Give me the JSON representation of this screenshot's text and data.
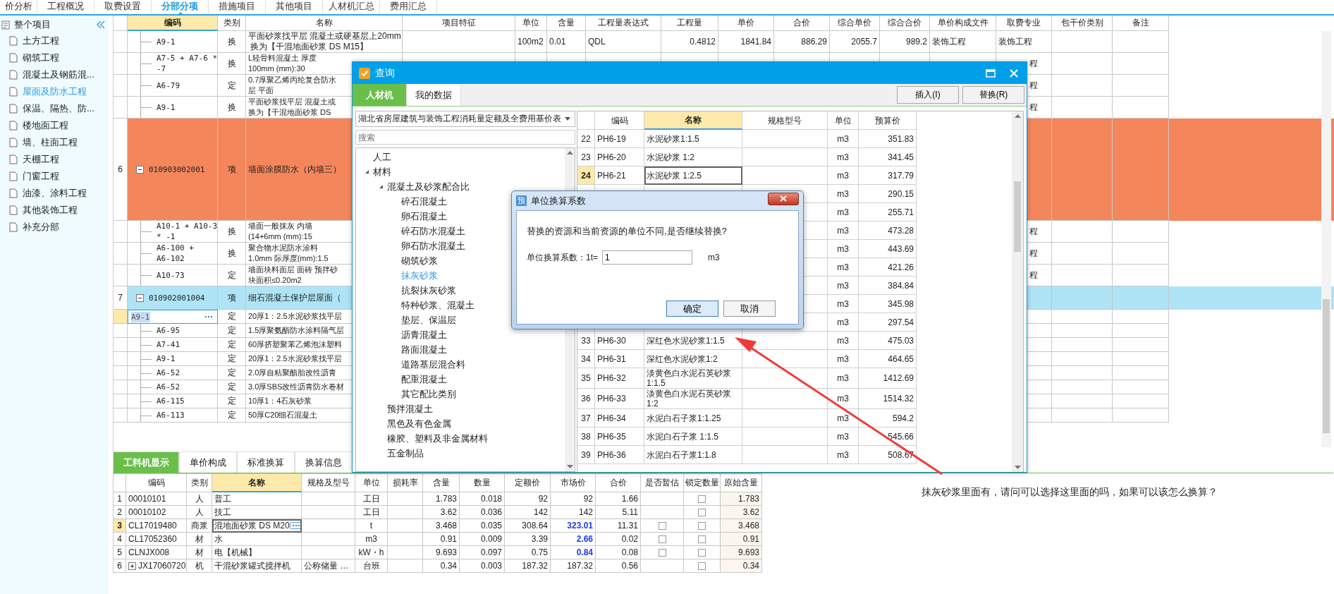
{
  "top_tabs": [
    {
      "label": "价分析",
      "selected": false
    },
    {
      "label": "工程概况",
      "selected": false
    },
    {
      "label": "取费设置",
      "selected": false
    },
    {
      "label": "分部分项",
      "selected": true
    },
    {
      "label": "措施项目",
      "selected": false
    },
    {
      "label": "其他项目",
      "selected": false
    },
    {
      "label": "人材机汇总",
      "selected": false
    },
    {
      "label": "费用汇总",
      "selected": false
    }
  ],
  "sidebar": {
    "root": "整个项目",
    "items": [
      {
        "label": "土方工程",
        "selected": false
      },
      {
        "label": "砌筑工程",
        "selected": false
      },
      {
        "label": "混凝土及钢筋混...",
        "selected": false
      },
      {
        "label": "屋面及防水工程",
        "selected": true
      },
      {
        "label": "保温、隔热、防...",
        "selected": false
      },
      {
        "label": "楼地面工程",
        "selected": false
      },
      {
        "label": "墙、柱面工程",
        "selected": false
      },
      {
        "label": "天棚工程",
        "selected": false
      },
      {
        "label": "门窗工程",
        "selected": false
      },
      {
        "label": "油漆、涂料工程",
        "selected": false
      },
      {
        "label": "其他装饰工程",
        "selected": false
      },
      {
        "label": "补充分部",
        "selected": false
      }
    ]
  },
  "grid": {
    "columns": [
      {
        "label": "编码",
        "current": true
      },
      {
        "label": "类别",
        "current": false
      },
      {
        "label": "名称",
        "current": false
      },
      {
        "label": "项目特征",
        "current": false
      },
      {
        "label": "单位",
        "current": false
      },
      {
        "label": "含量",
        "current": false
      },
      {
        "label": "工程量表达式",
        "current": false
      },
      {
        "label": "工程量",
        "current": false
      },
      {
        "label": "单价",
        "current": false
      },
      {
        "label": "合价",
        "current": false
      },
      {
        "label": "综合单价",
        "current": false
      },
      {
        "label": "综合合价",
        "current": false
      },
      {
        "label": "单价构成文件",
        "current": false
      },
      {
        "label": "取费专业",
        "current": false
      },
      {
        "label": "包干价类别",
        "current": false
      },
      {
        "label": "备注",
        "current": false
      }
    ],
    "groups": [
      {
        "children": [
          {
            "code": "A9-1",
            "type": "换",
            "name": "平面砂浆找平层 混凝土或硬基层上20mm\n 换为【干混地面砂浆 DS M15】",
            "covered": false,
            "editing": false,
            "cells": {
              "unit": "100m2",
              "ratio": "0.01",
              "expr": "QDL",
              "qty": "0.4812",
              "price": "1841.84",
              "total": "886.29",
              "cprice": "2055.7",
              "ctotal": "989.2",
              "file": "装饰工程",
              "fee": "装饰工程"
            }
          },
          {
            "code": "A7-5 + A7-6 *\n-7",
            "type": "换",
            "name": "L轻骨料混凝土 厚度100mm (mm):30",
            "covered": true,
            "editing": false,
            "cells": {
              "fee": "程"
            }
          },
          {
            "code": "A6-79",
            "type": "定",
            "name": "0.7厚聚乙烯丙纶复合防水层 平面",
            "covered": true,
            "editing": false,
            "cells": {
              "fee": "程"
            }
          },
          {
            "code": "A9-1",
            "type": "换",
            "name": "平面砂浆找平层 混凝土或换为【干混地面砂浆 DS",
            "covered": true,
            "editing": false,
            "cells": {
              "fee": "程"
            }
          }
        ]
      },
      {
        "item": {
          "num": "6",
          "code": "010903002001",
          "type": "项",
          "name": "墙面涂膜防水（内墙三）",
          "expanded": true,
          "selected": false
        },
        "children": [
          {
            "code": "A10-1 + A10-3\n* -1",
            "type": "换",
            "name": "墙面一般抹灰 内墙(14+6mm (mm):15",
            "covered": true,
            "editing": false,
            "cells": {
              "fee": "程"
            }
          },
          {
            "code": "A6-100 +\nA6-102",
            "type": "换",
            "name": "聚合物水泥防水涂料 1.0mm 际厚度(mm):1.5",
            "covered": true,
            "editing": false,
            "cells": {
              "fee": "程"
            }
          },
          {
            "code": "A10-73",
            "type": "定",
            "name": "墙面块料面层 面砖 预拌砂块面积≤0.20m2",
            "covered": true,
            "editing": false,
            "cells": {
              "fee": "程"
            }
          }
        ]
      },
      {
        "item": {
          "num": "7",
          "code": "010902001004",
          "type": "项",
          "name": "细石混凝土保护层屋面（",
          "expanded": true,
          "selected": true
        },
        "children": [
          {
            "code": "A9-1",
            "type": "定",
            "name": "20厚1：2.5水泥砂浆找平层",
            "covered": true,
            "editing": true
          },
          {
            "code": "A6-95",
            "type": "定",
            "name": "1.5厚聚氨酯防水涂料隔气层",
            "covered": true,
            "editing": false
          },
          {
            "code": "A7-41",
            "type": "定",
            "name": "60厚挤塑聚苯乙烯泡沫塑料",
            "covered": true,
            "editing": false
          },
          {
            "code": "A9-1",
            "type": "定",
            "name": "20厚1：2.5水泥砂浆找平层",
            "covered": true,
            "editing": false
          },
          {
            "code": "A6-52",
            "type": "定",
            "name": "2.0厚自粘聚酯胎改性沥青",
            "covered": true,
            "editing": false
          },
          {
            "code": "A6-52",
            "type": "定",
            "name": "3.0厚SBS改性沥青防水卷材",
            "covered": true,
            "editing": false
          },
          {
            "code": "A6-115",
            "type": "定",
            "name": "10厚1：4石灰砂浆",
            "covered": true,
            "editing": false
          },
          {
            "code": "A6-113",
            "type": "定",
            "name": "50厚C20细石混凝土",
            "covered": true,
            "editing": false
          }
        ]
      }
    ]
  },
  "bottom_tabs": [
    {
      "label": "工料机显示",
      "selected": true
    },
    {
      "label": "单价构成",
      "selected": false
    },
    {
      "label": "标准换算",
      "selected": false
    },
    {
      "label": "换算信息",
      "selected": false
    }
  ],
  "resource_table": {
    "columns": [
      {
        "label": "编码",
        "current": false
      },
      {
        "label": "类别",
        "current": false
      },
      {
        "label": "名称",
        "current": true
      },
      {
        "label": "规格及型号",
        "current": false
      },
      {
        "label": "单位",
        "current": false
      },
      {
        "label": "损耗率",
        "current": false
      },
      {
        "label": "含量",
        "current": false
      },
      {
        "label": "数量",
        "current": false
      },
      {
        "label": "定额价",
        "current": false
      },
      {
        "label": "市场价",
        "current": false
      },
      {
        "label": "合价",
        "current": false
      },
      {
        "label": "是否暂估",
        "current": false
      },
      {
        "label": "锁定数量",
        "current": false
      },
      {
        "label": "原始含量",
        "current": false
      }
    ],
    "rows": [
      {
        "num": "1",
        "code": "00010101",
        "type": "人",
        "name": "普工",
        "unit": "工日",
        "ratio": "1.783",
        "qty": "0.018",
        "quota_price": "92",
        "market_price": "92",
        "total": "1.66",
        "locked": {
          "checked": false
        },
        "original": "1.783",
        "selected": false,
        "adjusted": false
      },
      {
        "num": "2",
        "code": "00010102",
        "type": "人",
        "name": "技工",
        "unit": "工日",
        "ratio": "3.62",
        "qty": "0.036",
        "quota_price": "142",
        "market_price": "142",
        "total": "5.11",
        "locked": {
          "checked": false
        },
        "original": "3.62",
        "selected": false,
        "adjusted": false
      },
      {
        "num": "3",
        "code": "CL17019480",
        "type": "商浆",
        "name": "混地面砂浆 DS M20",
        "unit": "t",
        "ratio": "3.468",
        "qty": "0.035",
        "quota_price": "308.64",
        "market_price": "323.01",
        "total": "11.31",
        "estimate": {
          "checked": false
        },
        "locked": {
          "checked": false
        },
        "original": "3.468",
        "selected": true,
        "adjusted": true
      },
      {
        "num": "4",
        "code": "CL17052360",
        "type": "材",
        "name": "水",
        "unit": "m3",
        "ratio": "0.91",
        "qty": "0.009",
        "quota_price": "3.39",
        "market_price": "2.66",
        "total": "0.02",
        "estimate": {
          "checked": false
        },
        "locked": {
          "checked": false
        },
        "original": "0.91",
        "selected": false,
        "adjusted": true
      },
      {
        "num": "5",
        "code": "CLNJX008",
        "type": "材",
        "name": "电【机械】",
        "unit": "kW・h",
        "ratio": "9.693",
        "qty": "0.097",
        "quota_price": "0.75",
        "market_price": "0.84",
        "total": "0.08",
        "estimate": {
          "checked": false
        },
        "locked": {
          "checked": false
        },
        "original": "9.693",
        "selected": false,
        "adjusted": true
      },
      {
        "num": "6",
        "code": "JX17060720",
        "type": "机",
        "name": "干混砂浆罐式搅拌机",
        "spec": "公称储量 …",
        "unit": "台班",
        "ratio": "0.34",
        "qty": "0.003",
        "quota_price": "187.32",
        "market_price": "187.32",
        "total": "0.56",
        "locked": {
          "checked": false
        },
        "original": "0.34",
        "selected": false,
        "adjusted": false,
        "expanded": false
      }
    ]
  },
  "query_dialog": {
    "title": "查询",
    "tabs": [
      {
        "label": "人材机",
        "selected": true
      },
      {
        "label": "我的数据",
        "selected": false
      }
    ],
    "buttons": [
      "插入(I)",
      "替换(R)"
    ],
    "library": "湖北省房屋建筑与装饰工程消耗量定额及全费用基价表",
    "search": {
      "placeholder": "搜索"
    },
    "tree": [
      {
        "label": "人工",
        "selected": false
      },
      {
        "label": "材料",
        "selected": false,
        "expanded": true,
        "children": [
          {
            "label": "混凝土及砂浆配合比",
            "selected": false,
            "expanded": true,
            "children": [
              {
                "label": "碎石混凝土",
                "selected": false
              },
              {
                "label": "卵石混凝土",
                "selected": false
              },
              {
                "label": "碎石防水混凝土",
                "selected": false
              },
              {
                "label": "卵石防水混凝土",
                "selected": false
              },
              {
                "label": "砌筑砂浆",
                "selected": false
              },
              {
                "label": "抹灰砂浆",
                "selected": true
              },
              {
                "label": "抗裂抹灰砂浆",
                "selected": false
              },
              {
                "label": "特种砂浆、混凝土",
                "selected": false
              },
              {
                "label": "垫层、保温层",
                "selected": false
              },
              {
                "label": "沥青混凝土",
                "selected": false
              },
              {
                "label": "路面混凝土",
                "selected": false
              },
              {
                "label": "道路基层混合料",
                "selected": false
              },
              {
                "label": "配重混凝土",
                "selected": false
              },
              {
                "label": "其它配比类别",
                "selected": false
              }
            ]
          },
          {
            "label": "预拌混凝土",
            "selected": false
          },
          {
            "label": "黑色及有色金属",
            "selected": false
          },
          {
            "label": "橡胶、塑料及非金属材料",
            "selected": false
          },
          {
            "label": "五金制品",
            "selected": false
          }
        ]
      }
    ],
    "table": {
      "columns": [
        {
          "label": "编码",
          "current": false
        },
        {
          "label": "名称",
          "current": true
        },
        {
          "label": "规格型号",
          "current": false
        },
        {
          "label": "单位",
          "current": false
        },
        {
          "label": "预算价",
          "current": false
        }
      ],
      "rows": [
        {
          "num": "22",
          "code": "PH6-19",
          "name": "水泥砂浆1:1.5",
          "unit": "m3",
          "price": "351.83",
          "selected": false
        },
        {
          "num": "23",
          "code": "PH6-20",
          "name": "水泥砂浆 1:2",
          "unit": "m3",
          "price": "341.45",
          "selected": false
        },
        {
          "num": "24",
          "code": "PH6-21",
          "name": "水泥砂浆 1:2.5",
          "unit": "m3",
          "price": "317.79",
          "selected": true
        },
        {
          "unit": "m3",
          "price": "290.15",
          "selected": false
        },
        {
          "unit": "m3",
          "price": "255.71"
        },
        {
          "unit": "m3",
          "price": "473.28"
        },
        {
          "unit": "m3",
          "price": "443.69"
        },
        {
          "unit": "m3",
          "price": "421.26"
        },
        {
          "unit": "m3",
          "price": "384.84"
        },
        {
          "unit": "m3",
          "price": "345.98"
        },
        {
          "unit": "m3",
          "price": "297.54",
          "selected": false
        },
        {
          "num": "33",
          "code": "PH6-30",
          "name": "深红色水泥砂浆1:1.5",
          "unit": "m3",
          "price": "475.03",
          "selected": false
        },
        {
          "num": "34",
          "code": "PH6-31",
          "name": "深红色水泥砂浆1:2",
          "unit": "m3",
          "price": "464.65",
          "selected": false
        },
        {
          "num": "35",
          "code": "PH6-32",
          "name": "淡黄色白水泥石英砂浆1:1.5",
          "unit": "m3",
          "price": "1412.69",
          "selected": false
        },
        {
          "num": "36",
          "code": "PH6-33",
          "name": "淡黄色白水泥石英砂浆1:2",
          "unit": "m3",
          "price": "1514.32",
          "selected": false
        },
        {
          "num": "37",
          "code": "PH6-34",
          "name": "水泥白石子浆1:1.25",
          "unit": "m3",
          "price": "594.2",
          "selected": false
        },
        {
          "num": "38",
          "code": "PH6-35",
          "name": "水泥白石子浆 1:1.5",
          "unit": "m3",
          "price": "545.66",
          "selected": false
        },
        {
          "num": "39",
          "code": "PH6-36",
          "name": "水泥白石子浆1:1.8",
          "unit": "m3",
          "price": "508.67",
          "selected": false
        }
      ]
    }
  },
  "unit_dialog": {
    "icon_text": "预",
    "title": "单位换算系数",
    "message": "替换的资源和当前资源的单位不同,是否继续替换?",
    "label": "单位换算系数：1t=",
    "value": "1",
    "unit": "m3",
    "buttons": [
      "确定",
      "取消"
    ]
  },
  "annotation": "抹灰砂浆里面有，请问可以选择这里面的吗，如果可以该怎么换算？"
}
